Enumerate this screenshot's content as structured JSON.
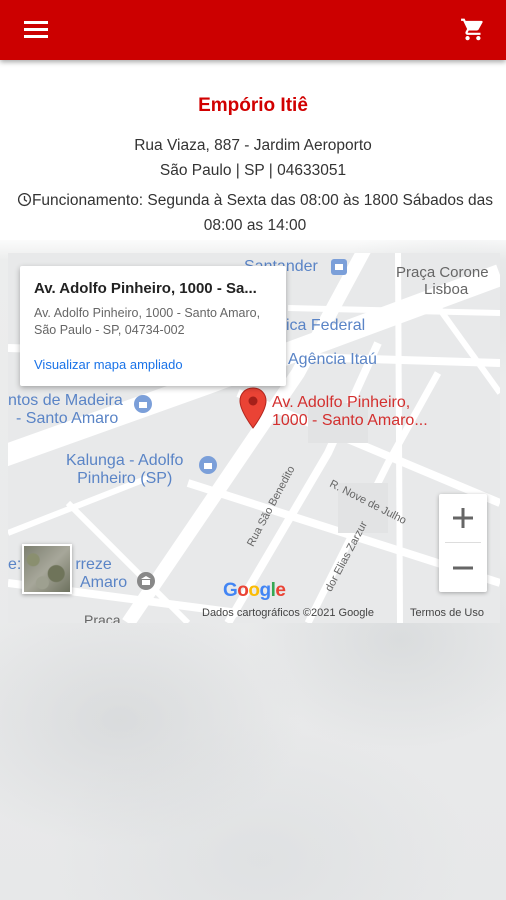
{
  "header": {
    "menu_icon": "hamburger-menu-icon",
    "cart_icon": "shopping-cart-icon",
    "bar_color": "#cc0000"
  },
  "store": {
    "name": "Empório Itiê",
    "address_line1": "Rua Viaza, 887 - Jardim Aeroporto",
    "address_line2": "São Paulo | SP | 04633051",
    "hours": "Funcionamento: Segunda à Sexta das 08:00 às 1800 Sábados das 08:00 as 14:00",
    "name_color": "#d10000"
  },
  "map": {
    "info_card": {
      "title": "Av. Adolfo Pinheiro, 1000 - Sa...",
      "address": "Av. Adolfo Pinheiro, 1000 - Santo Amaro, São Paulo - SP, 04734-002",
      "link": "Visualizar mapa ampliado"
    },
    "labels": {
      "santander": "Santander",
      "praca_coronel_1": "Praça Corone",
      "praca_coronel_2": "Lisboa",
      "caixa": "ica Federal",
      "itau": "Agência Itaú",
      "madeira_1": "ntos de Madeira",
      "madeira_2": "- Santo Amaro",
      "pin_1": "Av. Adolfo Pinheiro,",
      "pin_2": "1000 - Santo Amaro...",
      "kalunga_1": "Kalunga - Adolfo",
      "kalunga_2": "Pinheiro (SP)",
      "nove_julho": "R. Nove de Julho",
      "sao_benedito": "Rua São Benedito",
      "elias_zarzur": "dor Elias Zarzur",
      "treze_1": "e: U",
      "treze_2": "rreze",
      "treze_3": "Amaro",
      "praca_bottom": "Praça"
    },
    "zoom_in": "+",
    "zoom_out": "−",
    "google": "Google",
    "attribution": "Dados cartográficos ©2021 Google",
    "terms": "Termos de Uso"
  }
}
